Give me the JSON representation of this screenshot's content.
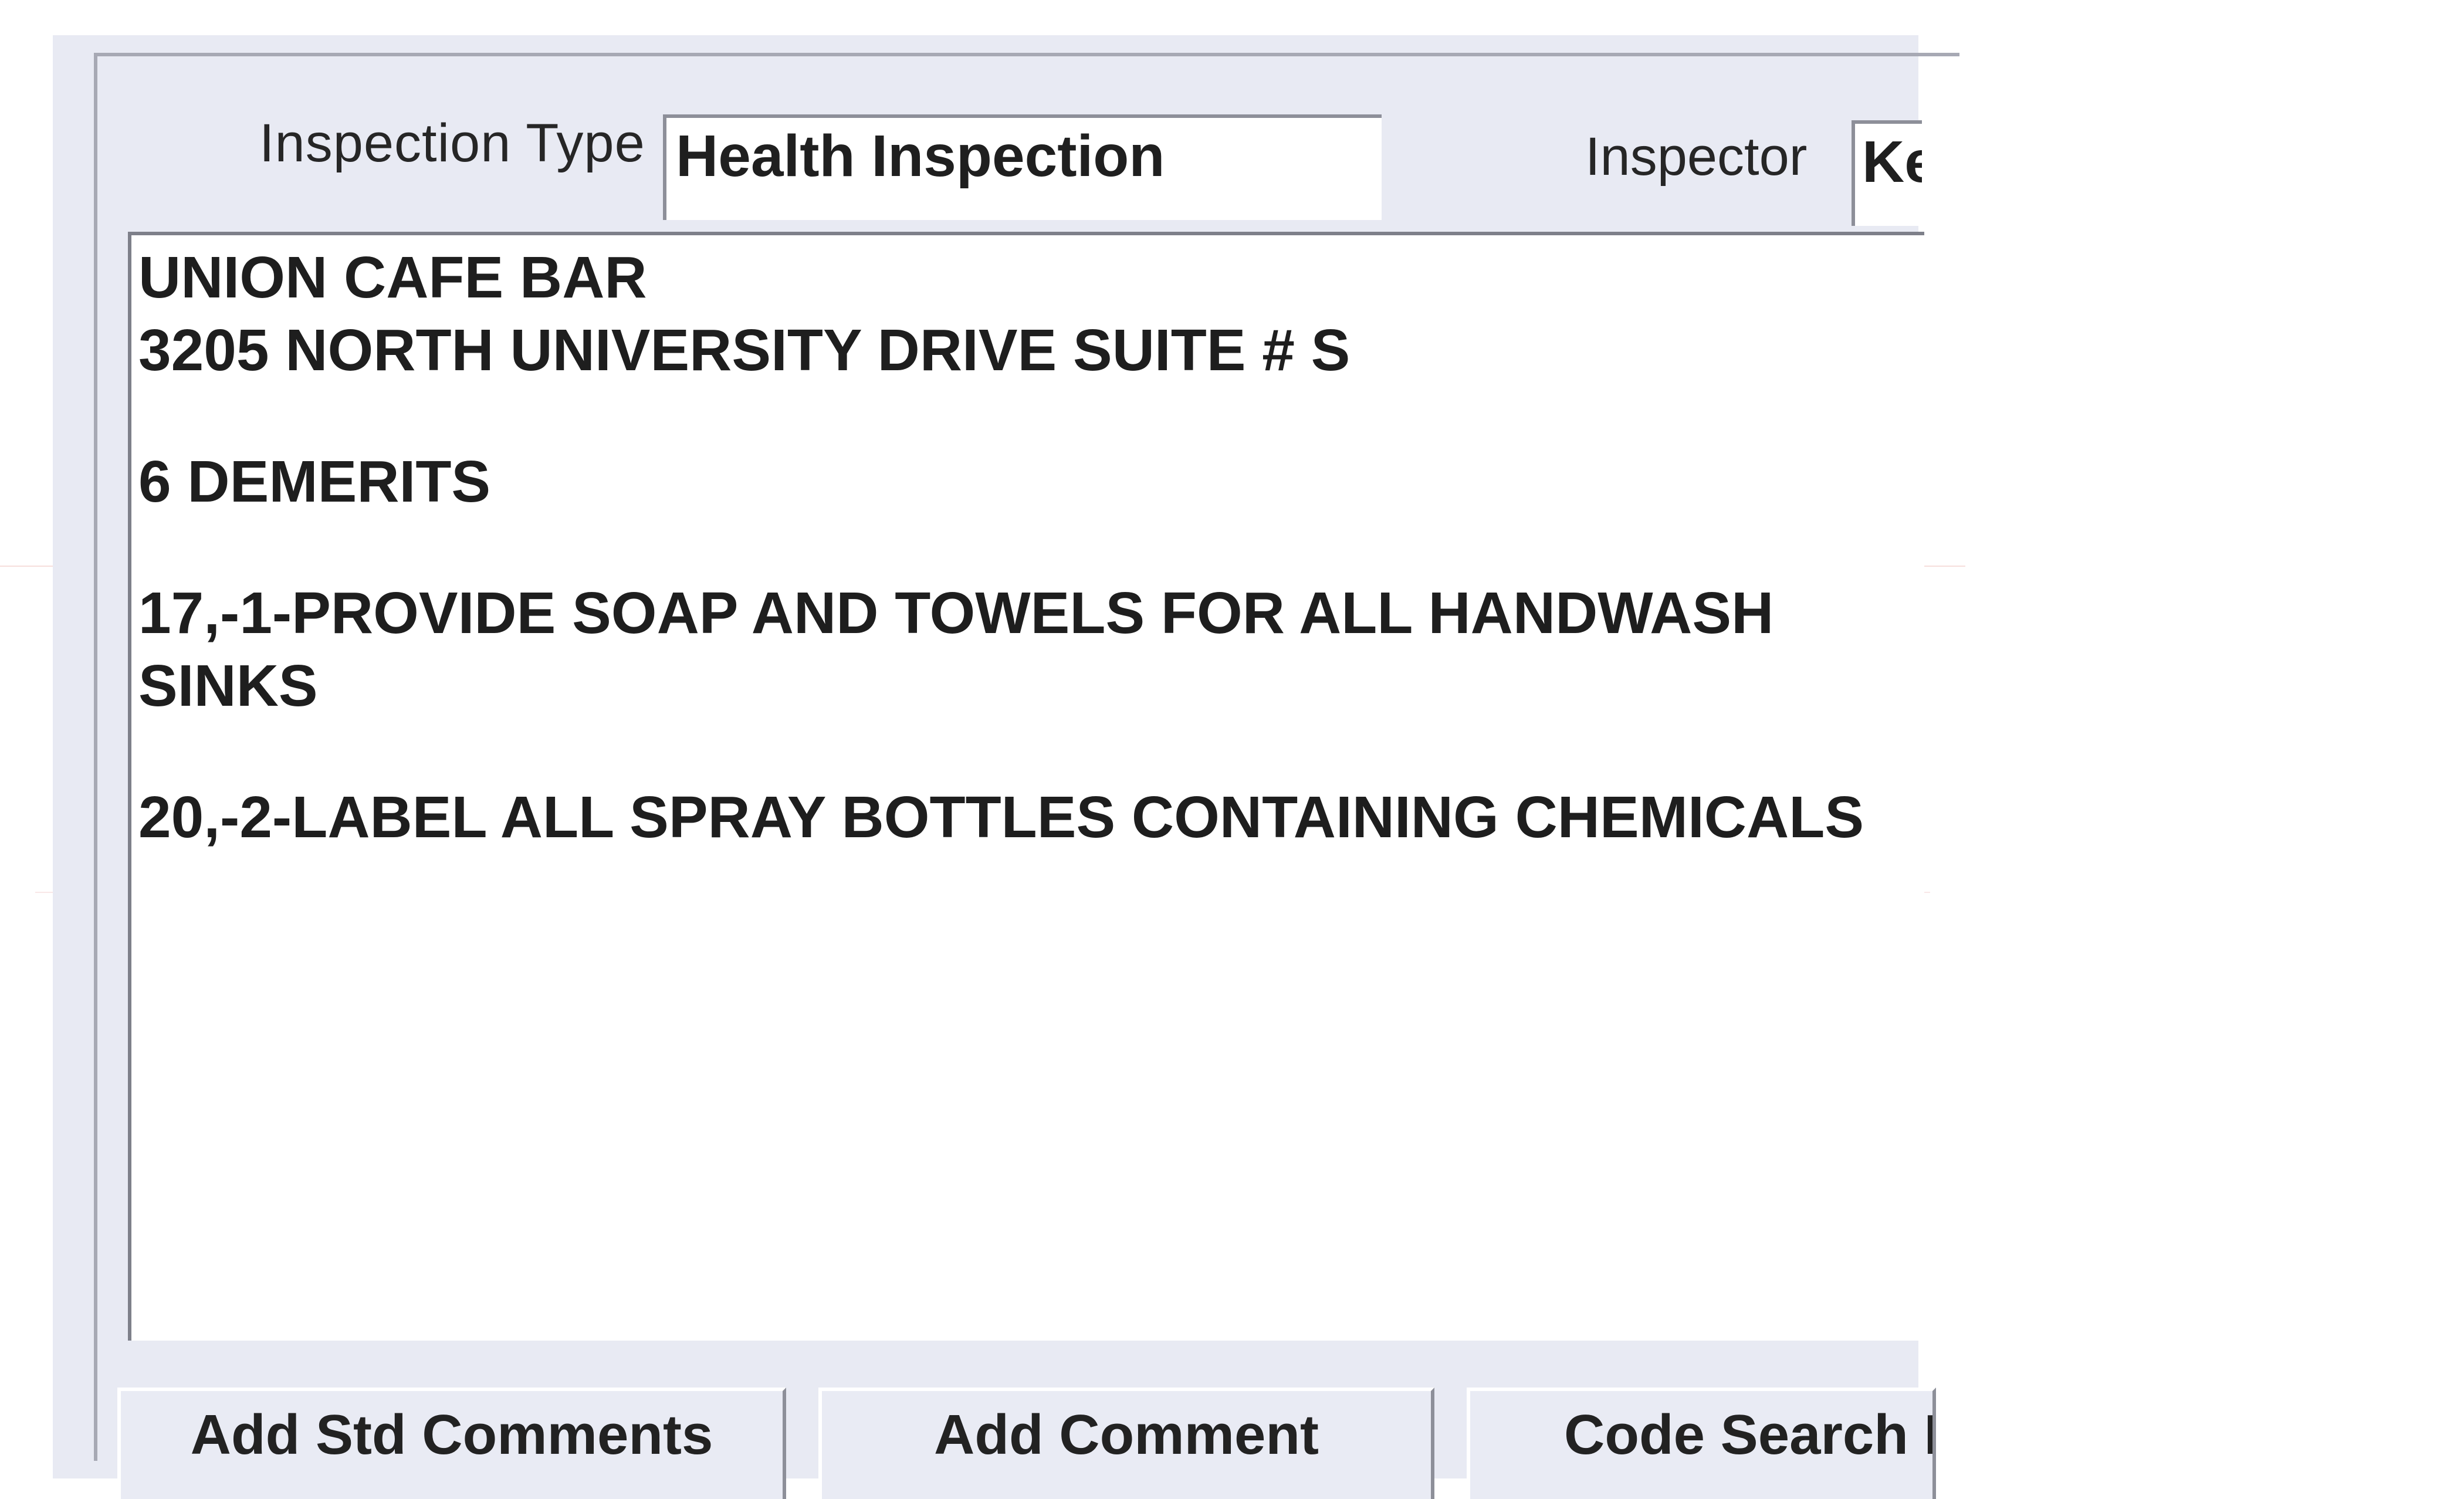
{
  "form": {
    "inspection_type_label": "Inspection Type",
    "inspection_type_value": "Health Inspection",
    "inspector_label": "Inspector",
    "inspector_value": "Ke"
  },
  "comments": {
    "lines": [
      "UNION CAFE BAR",
      "3205 NORTH UNIVERSITY DRIVE SUITE # S",
      "6 DEMERITS",
      "17,-1-PROVIDE SOAP AND TOWELS FOR ALL HANDWASH SINKS",
      "20,-2-LABEL ALL SPRAY BOTTLES CONTAINING CHEMICALS"
    ]
  },
  "buttons": {
    "add_std_comments": "Add Std Comments",
    "add_comment": "Add Comment",
    "code_search": "Code Search Li"
  }
}
